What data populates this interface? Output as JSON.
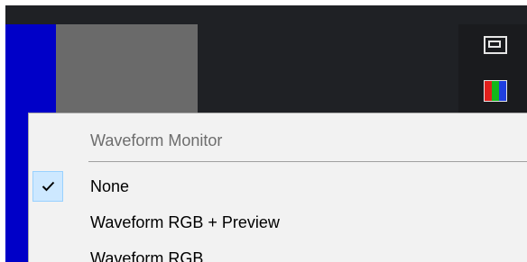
{
  "colors": {
    "dark_panel": "#1f2125",
    "blue_block": "#0000c8",
    "gray_block": "#6a6a6a",
    "menu_bg": "#f2f2f2",
    "menu_header_text": "#6d6d6d",
    "check_highlight": "#cde8ff"
  },
  "toolbar": {
    "monitor_icon": "display-frame-icon",
    "rgb_icon": "rgb-channels-icon"
  },
  "menu": {
    "header": "Waveform Monitor",
    "items": [
      {
        "label": "None",
        "checked": true
      },
      {
        "label": "Waveform RGB + Preview",
        "checked": false
      },
      {
        "label": "Waveform RGB",
        "checked": false
      }
    ],
    "check_icon": "checkmark-icon"
  }
}
